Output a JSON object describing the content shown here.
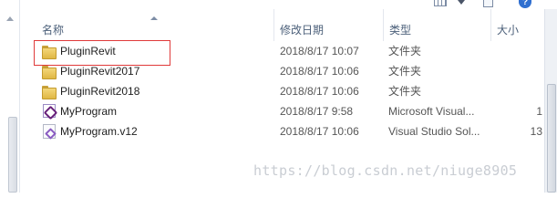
{
  "toolbar": {
    "view_icon": "view-options-icon",
    "preview_icon": "preview-pane-icon",
    "help_icon": "help-icon",
    "help_label": "?"
  },
  "columns": {
    "name": "名称",
    "date": "修改日期",
    "type": "类型",
    "size": "大小"
  },
  "files": [
    {
      "name": "PluginRevit",
      "date": "2018/8/17 10:07",
      "type": "文件夹",
      "size": "",
      "icon": "folder-icon"
    },
    {
      "name": "PluginRevit2017",
      "date": "2018/8/17 10:06",
      "type": "文件夹",
      "size": "",
      "icon": "folder-icon"
    },
    {
      "name": "PluginRevit2018",
      "date": "2018/8/17 10:06",
      "type": "文件夹",
      "size": "",
      "icon": "folder-icon"
    },
    {
      "name": "MyProgram",
      "date": "2018/8/17 9:58",
      "type": "Microsoft Visual...",
      "size": "1",
      "icon": "visual-studio-project-icon"
    },
    {
      "name": "MyProgram.v12",
      "date": "2018/8/17 10:06",
      "type": "Visual Studio Sol...",
      "size": "13",
      "icon": "visual-studio-solution-icon"
    }
  ],
  "watermark": "https://blog.csdn.net/niuge8905",
  "colors": {
    "highlight": "#e03a3a",
    "folder": "#f4d77a",
    "header_text": "#4c607a"
  }
}
